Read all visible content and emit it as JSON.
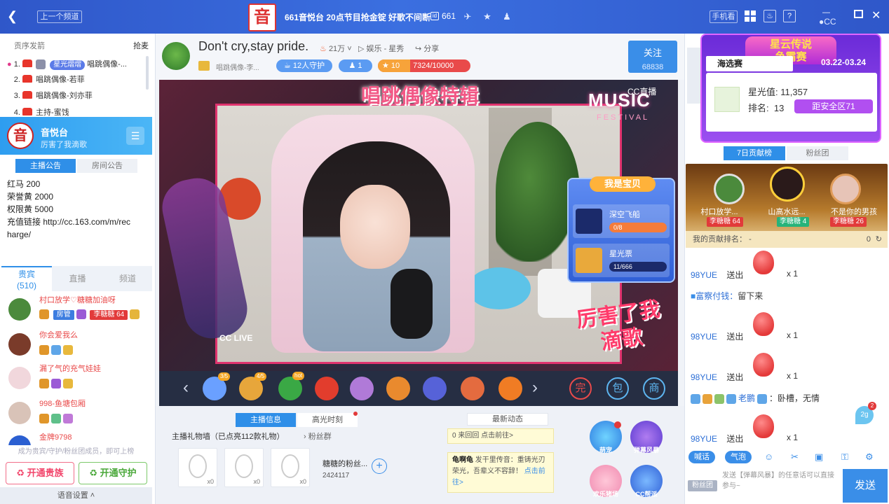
{
  "topbar": {
    "prev_channel": "上一个频道",
    "logo_text": "音",
    "title": "661音悦台 20点节目抢金锭 好歌不间断",
    "channel_no": "661",
    "phone_watch": "手机看"
  },
  "left": {
    "tab_ranks": "贡序发箭",
    "tab_grab": "抢麦",
    "ranks": [
      {
        "num": "1.",
        "pill": "星光熠熠",
        "name": "唱跳偶像-..."
      },
      {
        "num": "2.",
        "name": "唱跳偶像-若菲"
      },
      {
        "num": "3.",
        "name": "唱跳偶像-刘亦菲"
      },
      {
        "num": "4.",
        "name": "主持-蜜饯"
      }
    ],
    "channel": {
      "logo": "音",
      "name": "音悦台",
      "subtitle": "厉害了我滴歌"
    },
    "notice_tabs": [
      "主播公告",
      "房间公告"
    ],
    "notice_lines": [
      "红马 200",
      "荣誉黄 2000",
      "权限黄 5000",
      "充值链接 http://cc.163.com/m/rec",
      "harge/"
    ],
    "viewer_tabs": {
      "vip": "贵宾",
      "vip_count": "(510)",
      "live": "直播",
      "channel": "频道"
    },
    "viewers": [
      {
        "name": "村口放学♡糖糖加油呀",
        "role": "房管",
        "anchor_tag": "李糖糖",
        "level": "64",
        "avatar_color": "#4b8a3c"
      },
      {
        "name": "你会爱我么",
        "avatar_color": "#7a3b2a"
      },
      {
        "name": "漏了气的充气娃娃",
        "avatar_color": "#f1d7dc"
      },
      {
        "name": "998-鱼塘包厢",
        "avatar_color": "#d9c3b8"
      },
      {
        "name": "金牌9798",
        "avatar_color": "#2b5fd1"
      }
    ],
    "become_hint": "成为贵宾/守护/粉丝团成员，即可上榜",
    "open_vip": "开通贵族",
    "open_guard": "开通守护",
    "voice_settings": "语音设置"
  },
  "header": {
    "title": "Don't cry,stay pride.",
    "heat": "21万",
    "category": "娱乐 - 星秀",
    "share": "分享",
    "anchor_sub": "唱跳偶像-李...",
    "guards": "12人守护",
    "fans": "1",
    "level": "10",
    "exp": "7324/10000",
    "follow": "关注",
    "follow_count": "68838"
  },
  "video": {
    "banner": "唱跳偶像特辑",
    "music": "MUSIC",
    "festival": "FESTIVAL",
    "watermark": "CC直播",
    "cc_live": "CC LIVE",
    "badge_song": "厉害了我滴歌",
    "panel": {
      "title": "我是宝贝",
      "items": [
        {
          "name": "深空飞船",
          "progress": "0/8"
        },
        {
          "name": "星光票",
          "progress": "11/666"
        }
      ]
    }
  },
  "giftbar": {
    "prev": "‹",
    "next": "›",
    "gifts": [
      {
        "color": "#6aa0ff",
        "tag": "3/5"
      },
      {
        "color": "#e7a63b",
        "tag": "4/5"
      },
      {
        "color": "#3aa845",
        "tag": "hot"
      },
      {
        "color": "#e23d2d"
      },
      {
        "color": "#b07ad8"
      },
      {
        "color": "#e98a2e"
      },
      {
        "color": "#5662d8"
      },
      {
        "color": "#e46b3f"
      },
      {
        "color": "#f07c24"
      }
    ],
    "icons": [
      "完",
      "包",
      "商"
    ]
  },
  "bottom": {
    "tab_info": "主播信息",
    "tab_moments": "高光时刻",
    "wall_title": "主播礼物墙（已点亮112款礼物）",
    "fan_group": "粉丝群",
    "fan_group_name": "糖糖的粉丝...",
    "fan_group_id": "2424117",
    "thumbs": [
      "x0",
      "x0",
      "x0"
    ],
    "news_title": "最新动态",
    "news_1": "0 来回回 点击前往>",
    "news_2_user": "龟啊龟",
    "news_2_text": "发干里传音：重铸光刃荣光，吾辈义不容辞！",
    "news_2_link": "点击前往>",
    "actions": [
      "萌宠",
      "弹幕风暴",
      "欢乐猪场",
      "CC帮派"
    ]
  },
  "right": {
    "event": {
      "title_1": "星云传说",
      "title_2": "争霸赛",
      "stage": "海选赛",
      "dates": "03.22-03.24",
      "star_label": "星光值:",
      "star_value": "11,357",
      "rank_label": "排名:",
      "rank_value": "13",
      "gap": "距安全区71"
    },
    "contrib_tabs": [
      "7日贡献榜",
      "粉丝团"
    ],
    "top3": [
      {
        "name": "村口放学...",
        "tag": "李糖糖",
        "level": "64"
      },
      {
        "name": "山高水远...",
        "tag": "李糖糖",
        "level": "4"
      },
      {
        "name": "不是你的男孩",
        "tag": "李糖糖",
        "level": "26"
      }
    ],
    "my_rank_label": "我的贡献排名：",
    "my_rank_value": "-",
    "my_score": "0",
    "chat": [
      {
        "user": "98YUE",
        "verb": "送出",
        "count": "x 1"
      },
      {
        "user": "富察付钱：",
        "text": "留下来"
      },
      {
        "user": "98YUE",
        "verb": "送出",
        "count": "x 1"
      },
      {
        "user": "98YUE",
        "verb": "送出",
        "count": "x 1"
      },
      {
        "user": "老鹏",
        "text": "：卧槽，无情"
      },
      {
        "user": "98YUE",
        "verb": "送出",
        "count": "x 1"
      }
    ],
    "balloon": "2g",
    "balloon_count": "2",
    "chat_tools": [
      "喊话",
      "气泡"
    ],
    "fan_group_btn": "粉丝团",
    "input_placeholder": "发送【弹幕风暴】的任意话可以直接参与~",
    "send": "发送"
  }
}
